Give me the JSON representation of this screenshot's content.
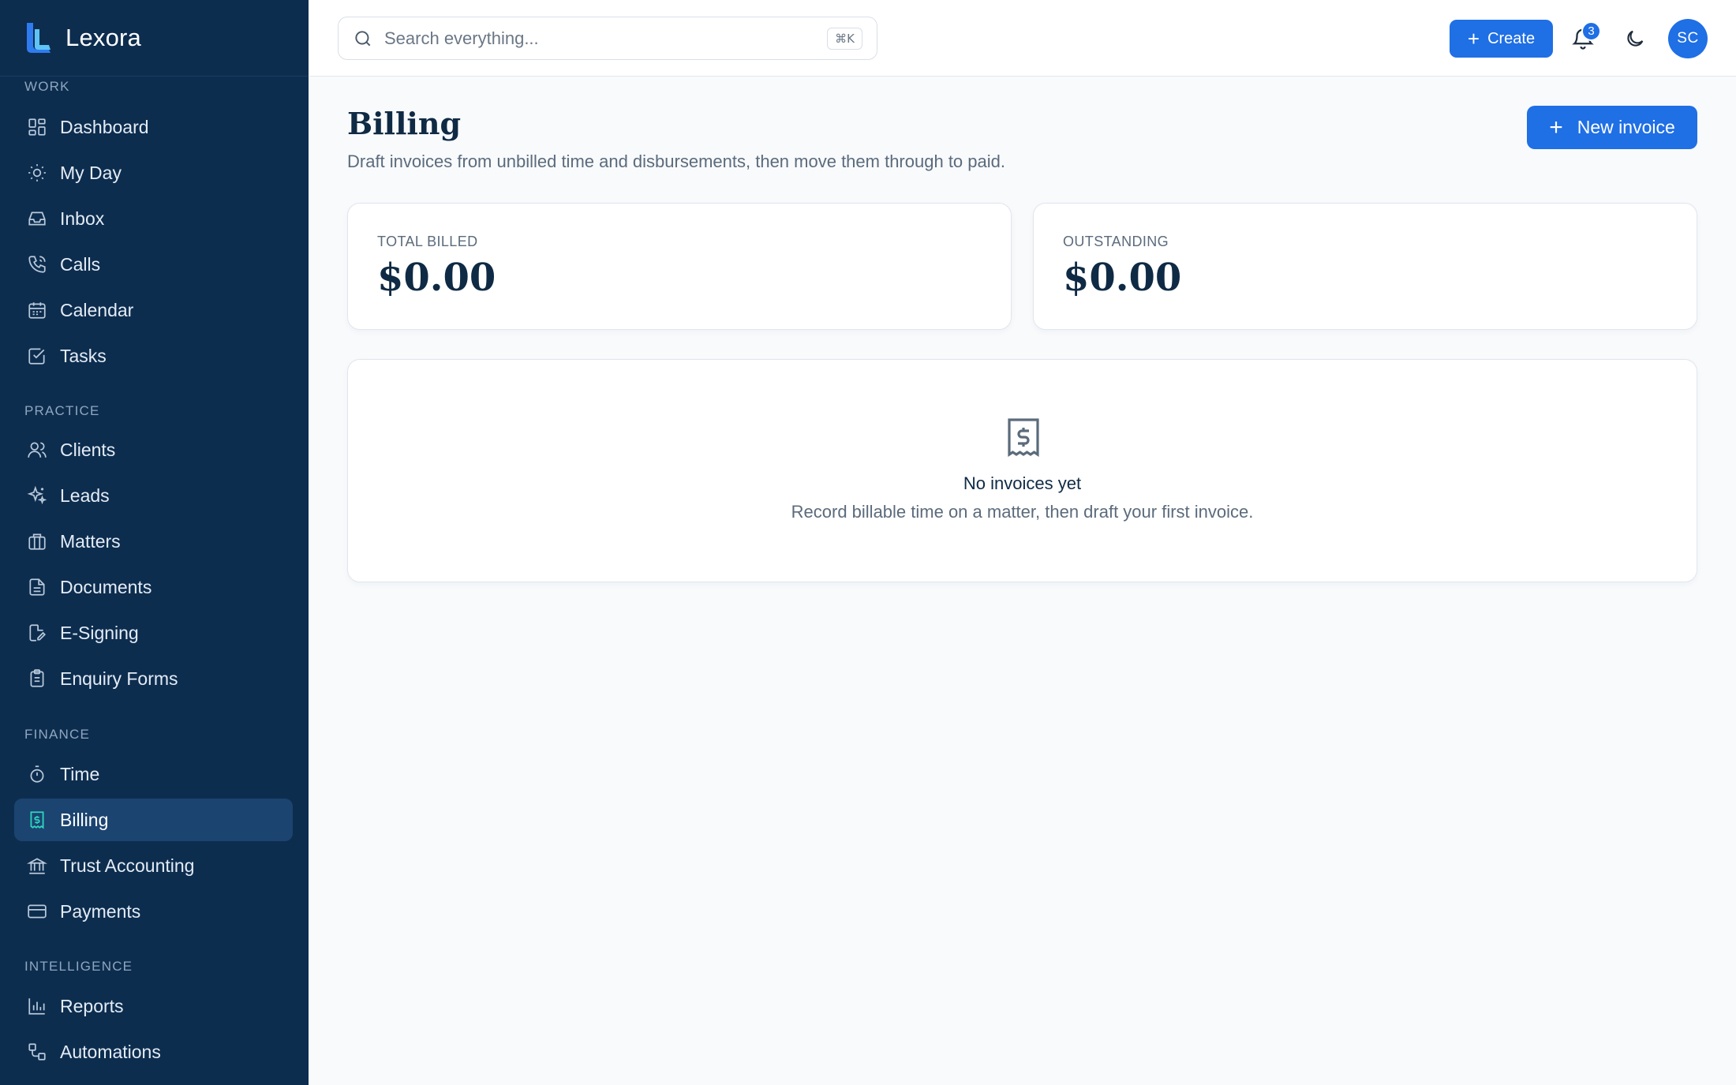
{
  "app": {
    "name": "Lexora"
  },
  "sidebar": {
    "sections": [
      {
        "label": "WORK"
      },
      {
        "label": "PRACTICE"
      },
      {
        "label": "FINANCE"
      },
      {
        "label": "INTELLIGENCE"
      }
    ],
    "items": [
      {
        "label": "Dashboard",
        "icon": "dashboard-icon"
      },
      {
        "label": "My Day",
        "icon": "sun-icon"
      },
      {
        "label": "Inbox",
        "icon": "inbox-icon"
      },
      {
        "label": "Calls",
        "icon": "phone-icon"
      },
      {
        "label": "Calendar",
        "icon": "calendar-icon"
      },
      {
        "label": "Tasks",
        "icon": "checkbox-icon"
      },
      {
        "label": "Clients",
        "icon": "users-icon"
      },
      {
        "label": "Leads",
        "icon": "sparkles-icon"
      },
      {
        "label": "Matters",
        "icon": "briefcase-icon"
      },
      {
        "label": "Documents",
        "icon": "document-icon"
      },
      {
        "label": "E-Signing",
        "icon": "signature-icon"
      },
      {
        "label": "Enquiry Forms",
        "icon": "clipboard-icon"
      },
      {
        "label": "Time",
        "icon": "stopwatch-icon"
      },
      {
        "label": "Billing",
        "icon": "receipt-icon",
        "active": true
      },
      {
        "label": "Trust Accounting",
        "icon": "bank-icon"
      },
      {
        "label": "Payments",
        "icon": "credit-card-icon"
      },
      {
        "label": "Reports",
        "icon": "bar-chart-icon"
      },
      {
        "label": "Automations",
        "icon": "workflow-icon"
      }
    ]
  },
  "topbar": {
    "search_placeholder": "Search everything...",
    "search_shortcut": "⌘K",
    "create_label": "Create",
    "notification_count": "3",
    "avatar_initials": "SC"
  },
  "page": {
    "title": "Billing",
    "subtitle": "Draft invoices from unbilled time and disbursements, then move them through to paid.",
    "new_invoice_label": "New invoice"
  },
  "stats": [
    {
      "label": "TOTAL BILLED",
      "value": "$0.00"
    },
    {
      "label": "OUTSTANDING",
      "value": "$0.00"
    }
  ],
  "empty_state": {
    "title": "No invoices yet",
    "text": "Record billable time on a matter, then draft your first invoice."
  },
  "colors": {
    "sidebar_bg": "#0d2d4f",
    "sidebar_active": "#1b4470",
    "accent": "#1f6fe5",
    "active_icon": "#2dd4bf",
    "page_bg": "#f8fafc"
  }
}
